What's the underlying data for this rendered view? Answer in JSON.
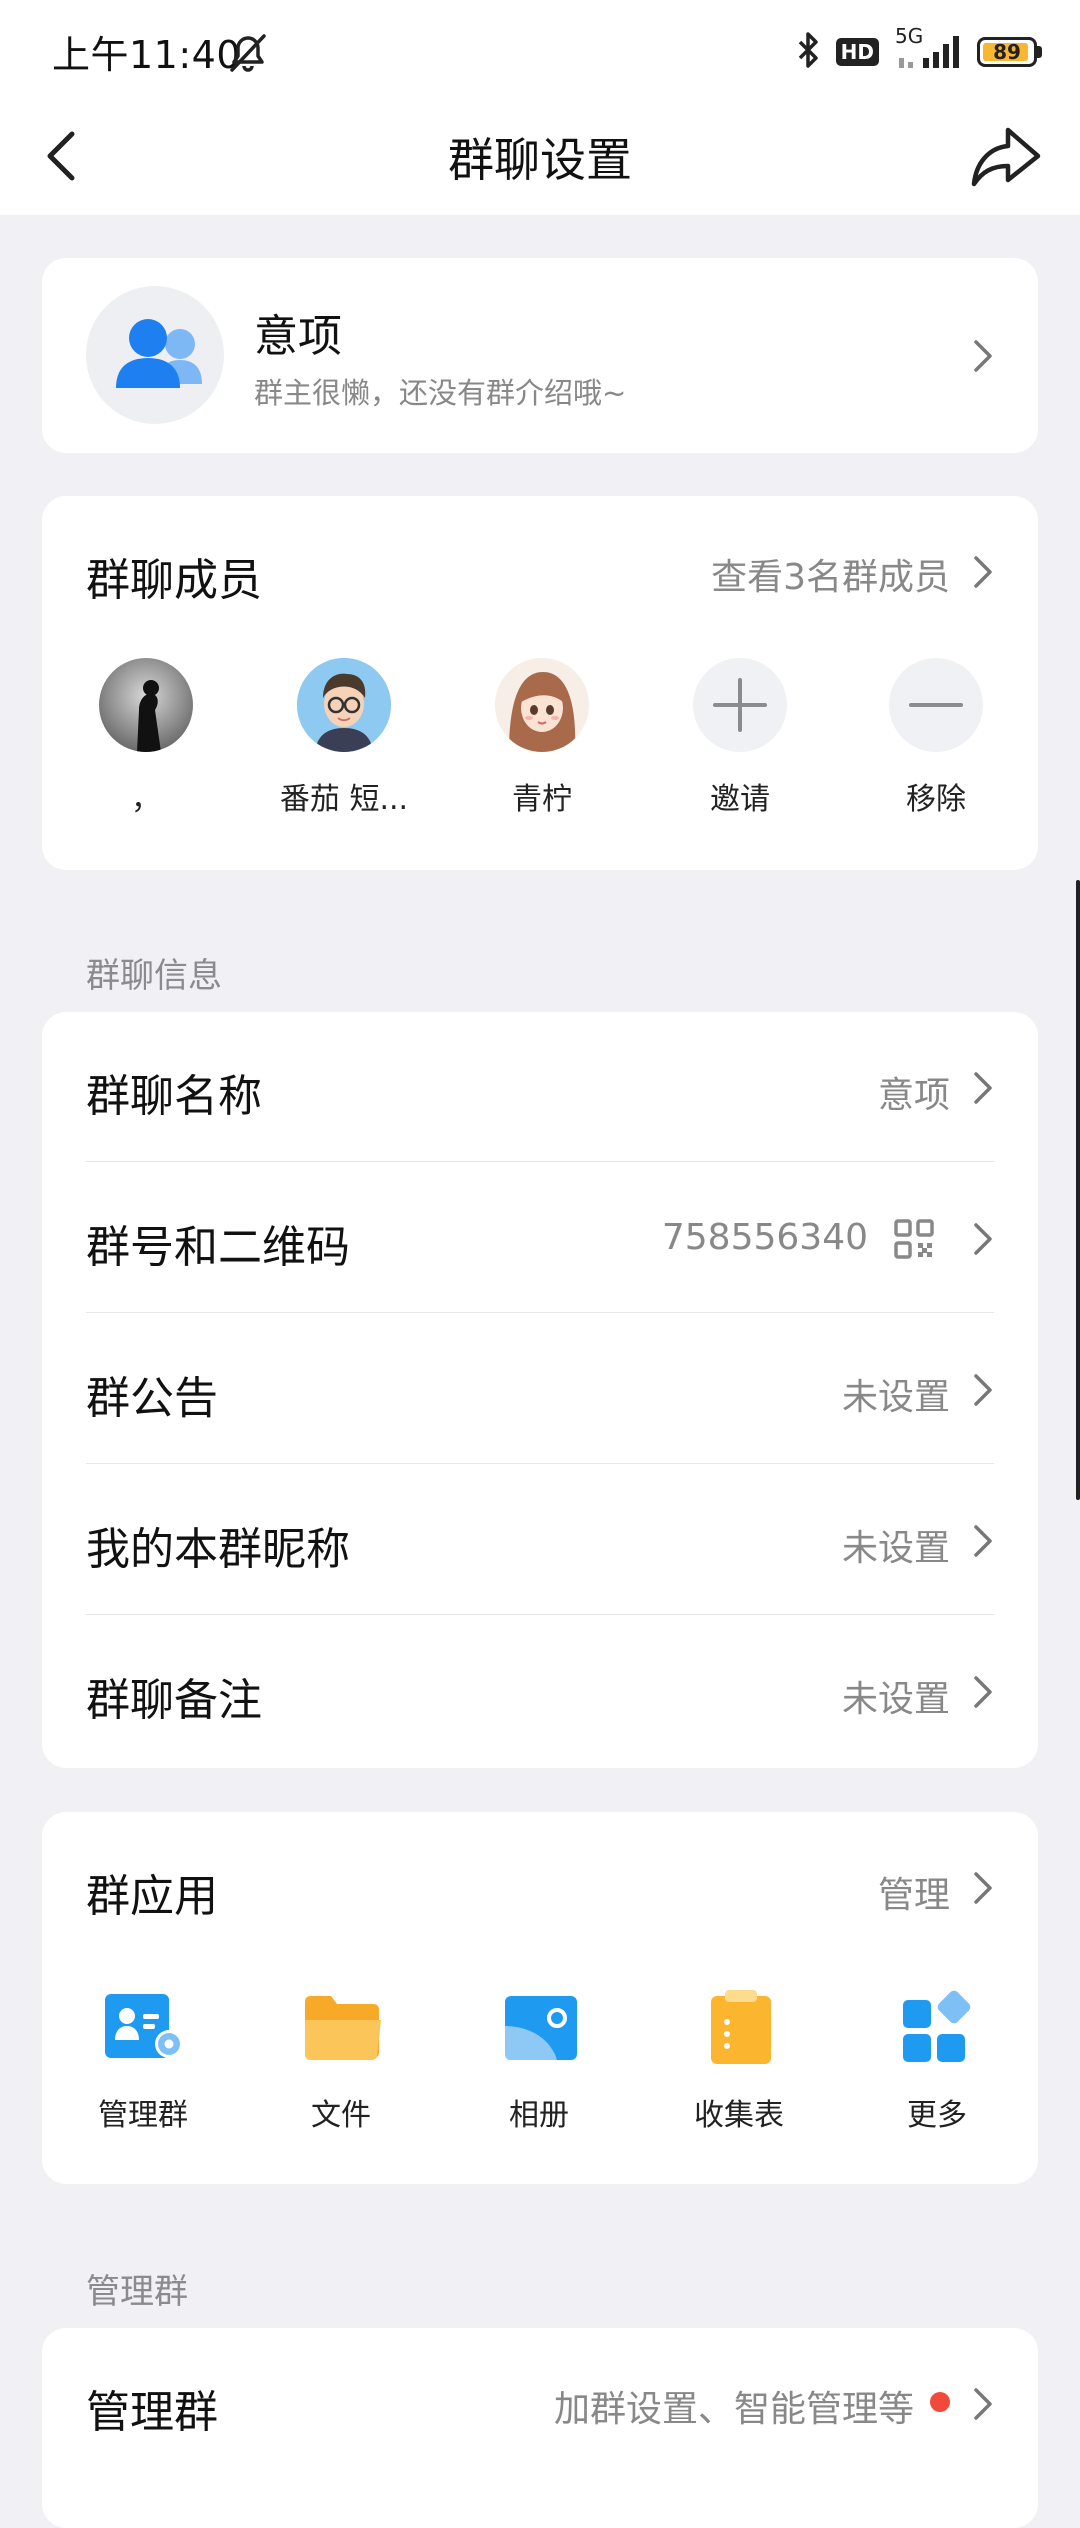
{
  "status_bar": {
    "time": "上午11:40",
    "hd": "HD",
    "network": "5G",
    "battery": "89"
  },
  "nav": {
    "title": "群聊设置"
  },
  "group": {
    "name": "意项",
    "intro": "群主很懒，还没有群介绍哦~"
  },
  "members": {
    "title": "群聊成员",
    "view_all": "查看3名群成员",
    "list": [
      {
        "name": "，"
      },
      {
        "name": "番茄 短..."
      },
      {
        "name": "青柠"
      }
    ],
    "invite_label": "邀请",
    "remove_label": "移除"
  },
  "info_section_label": "群聊信息",
  "info": {
    "group_name": {
      "label": "群聊名称",
      "value": "意项"
    },
    "group_id": {
      "label": "群号和二维码",
      "value": "758556340"
    },
    "announcement": {
      "label": "群公告",
      "value": "未设置"
    },
    "my_nickname": {
      "label": "我的本群昵称",
      "value": "未设置"
    },
    "remark": {
      "label": "群聊备注",
      "value": "未设置"
    }
  },
  "apps": {
    "title": "群应用",
    "manage_label": "管理",
    "items": [
      {
        "label": "管理群",
        "icon": "admin-group-icon"
      },
      {
        "label": "文件",
        "icon": "folder-icon"
      },
      {
        "label": "相册",
        "icon": "album-icon"
      },
      {
        "label": "收集表",
        "icon": "clipboard-icon"
      },
      {
        "label": "更多",
        "icon": "more-apps-icon"
      }
    ]
  },
  "manage_section_label": "管理群",
  "manage": {
    "label": "管理群",
    "value": "加群设置、智能管理等"
  },
  "colors": {
    "accent": "#1E9BF0",
    "background": "#F0F0F5",
    "secondary_text": "#888888",
    "folder": "#F9B43A",
    "battery": "#F7B731",
    "red_dot": "#F04A3C"
  }
}
